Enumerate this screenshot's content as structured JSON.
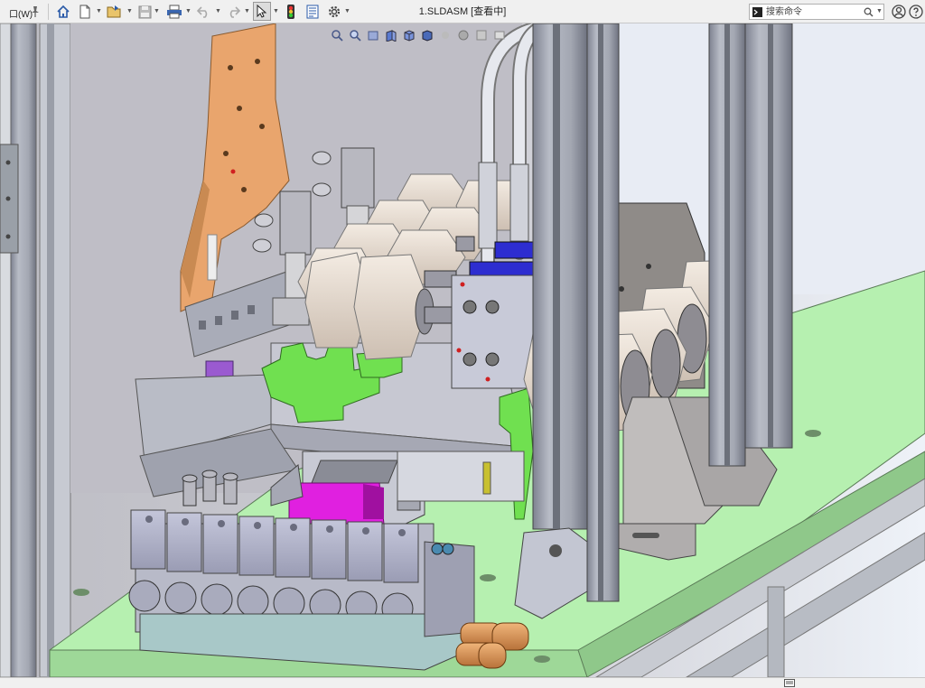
{
  "app": {
    "window_menu": "口(W)",
    "document_title": "1.SLDASM [查看中]"
  },
  "toolbar": {
    "icons": [
      "pin-icon",
      "home-icon",
      "new-document-icon",
      "open-icon",
      "save-icon",
      "print-icon",
      "undo-icon",
      "redo-icon",
      "select-icon",
      "traffic-light-icon",
      "file-properties-icon",
      "options-gear-icon"
    ]
  },
  "search": {
    "placeholder": "搜索命令"
  },
  "heads_up_toolbar": {
    "icons": [
      "zoom-to-fit-icon",
      "zoom-area-icon",
      "previous-view-icon",
      "section-view-icon",
      "view-orientation-icon",
      "display-style-icon",
      "hide-show-icon",
      "appearance-icon",
      "scene-icon",
      "view-settings-icon"
    ]
  },
  "colors": {
    "frame_gray": "#a9acb4",
    "plate_green": "#b6f0b0",
    "bracket_orange": "#e9a56d",
    "valve_blue_gray": "#aeb0c8",
    "bright_green": "#70e050",
    "magenta": "#e020e0",
    "purple": "#9a5ad0",
    "brass": "#d9955a",
    "nut_cream": "#ece1d6"
  }
}
